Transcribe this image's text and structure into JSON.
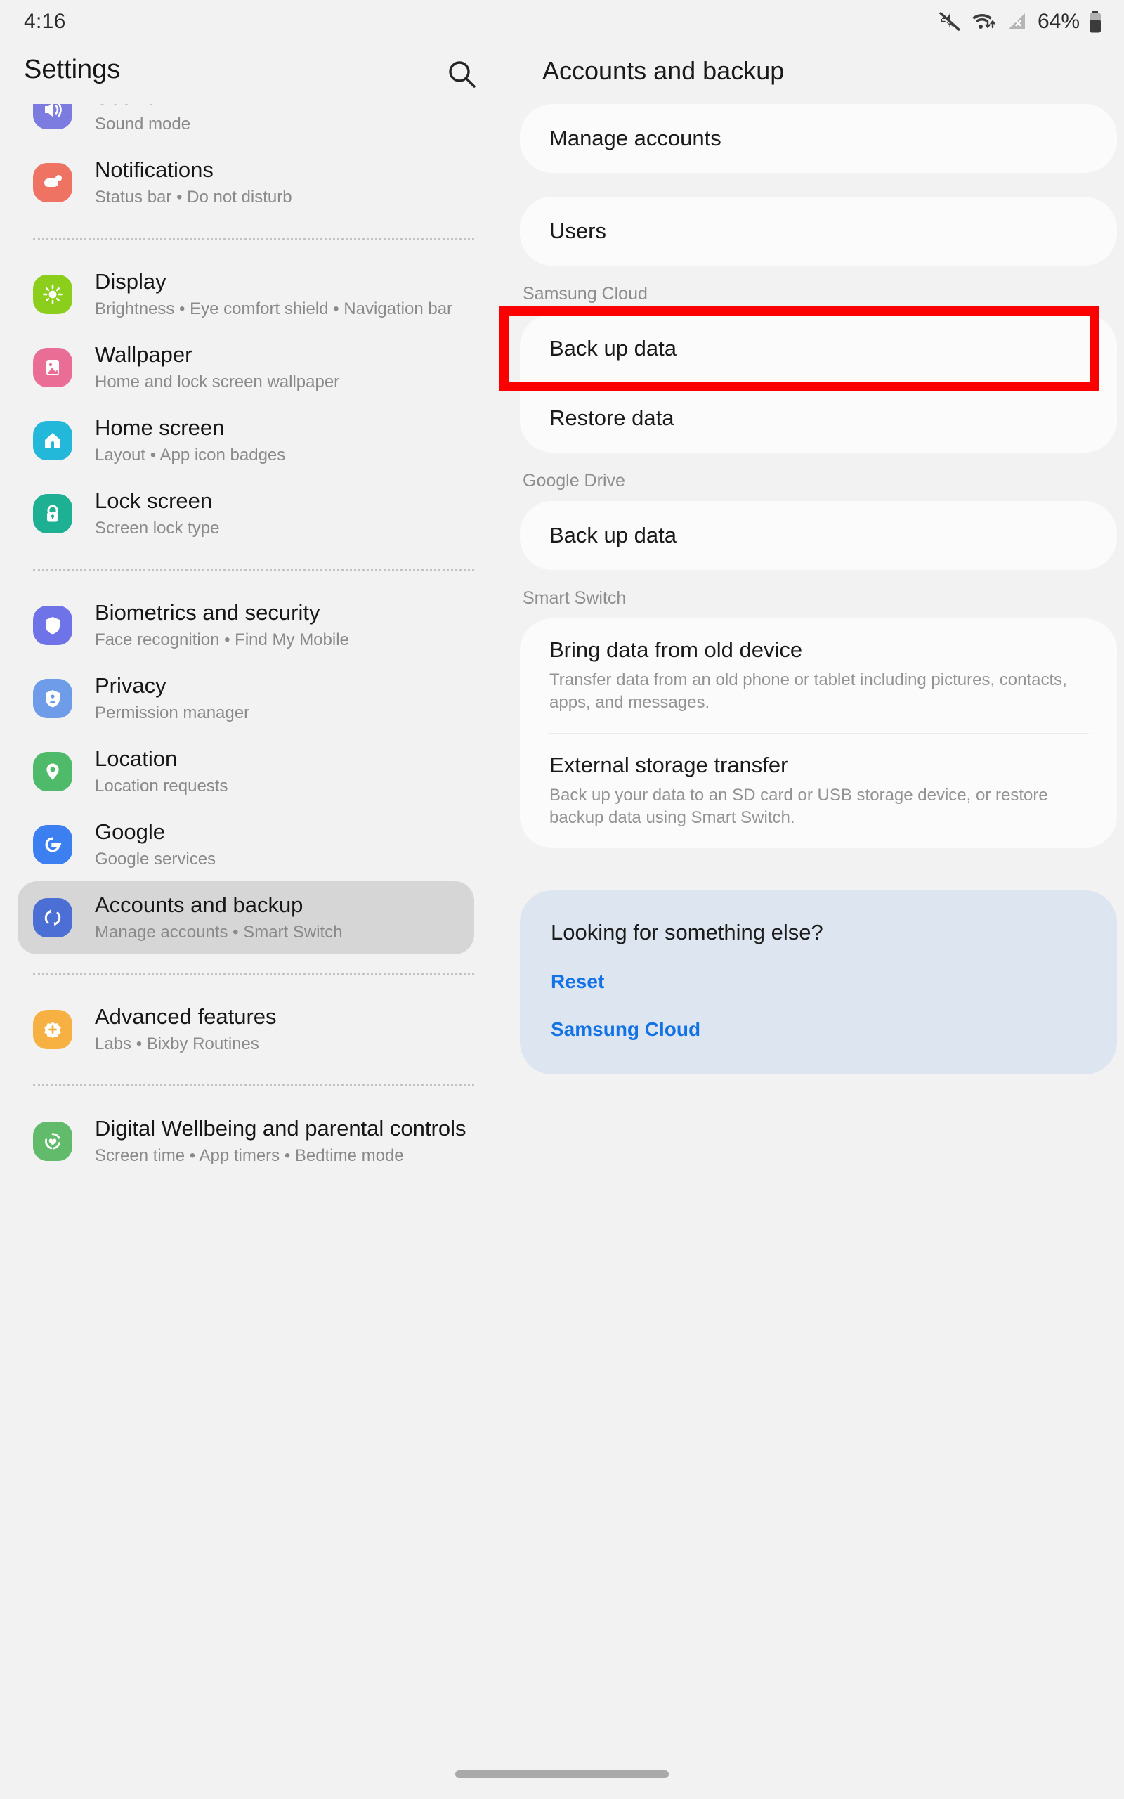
{
  "status_bar": {
    "time": "4:16",
    "battery_percent": "64%",
    "icons": [
      "mute-icon",
      "wifi-transfer-icon",
      "no-sim-signal-icon",
      "battery-icon"
    ]
  },
  "header": {
    "settings_label": "Settings",
    "search_icon": "search-icon",
    "page_title": "Accounts and backup"
  },
  "sidebar": {
    "items": [
      {
        "title": "Sound",
        "subtitle": "Sound mode",
        "icon": "sound-icon",
        "color": "#7c7ce0",
        "clipped": true
      },
      {
        "title": "Notifications",
        "subtitle": "Status bar  •  Do not disturb",
        "icon": "notifications-icon",
        "color": "#ef7363"
      },
      {
        "title": "Display",
        "subtitle": "Brightness  •  Eye comfort shield  •  Navigation bar",
        "icon": "display-icon",
        "color": "#8bcf1c"
      },
      {
        "title": "Wallpaper",
        "subtitle": "Home and lock screen wallpaper",
        "icon": "wallpaper-icon",
        "color": "#ea6d96"
      },
      {
        "title": "Home screen",
        "subtitle": "Layout  •  App icon badges",
        "icon": "home-screen-icon",
        "color": "#23b8d9"
      },
      {
        "title": "Lock screen",
        "subtitle": "Screen lock type",
        "icon": "lock-screen-icon",
        "color": "#1eb093"
      },
      {
        "title": "Biometrics and security",
        "subtitle": "Face recognition  •  Find My Mobile",
        "icon": "shield-icon",
        "color": "#6e74e8"
      },
      {
        "title": "Privacy",
        "subtitle": "Permission manager",
        "icon": "privacy-shield-icon",
        "color": "#6e9ce8"
      },
      {
        "title": "Location",
        "subtitle": "Location requests",
        "icon": "location-pin-icon",
        "color": "#4fbb6a"
      },
      {
        "title": "Google",
        "subtitle": "Google services",
        "icon": "google-g-icon",
        "color": "#3b7ff0"
      },
      {
        "title": "Accounts and backup",
        "subtitle": "Manage accounts  •  Smart Switch",
        "icon": "sync-accounts-icon",
        "color": "#4b6fd4",
        "selected": true
      },
      {
        "title": "Advanced features",
        "subtitle": "Labs  •  Bixby Routines",
        "icon": "advanced-gear-icon",
        "color": "#f7b042"
      },
      {
        "title": "Digital Wellbeing and parental controls",
        "subtitle": "Screen time  •  App timers  •  Bedtime mode",
        "icon": "wellbeing-heart-icon",
        "color": "#62bb6a"
      }
    ]
  },
  "main": {
    "top_rows": [
      {
        "title": "Manage accounts"
      },
      {
        "title": "Users"
      }
    ],
    "groups": [
      {
        "label": "Samsung Cloud",
        "rows": [
          {
            "title": "Back up data",
            "highlighted": true
          },
          {
            "title": "Restore data"
          }
        ]
      },
      {
        "label": "Google Drive",
        "rows": [
          {
            "title": "Back up data"
          }
        ]
      },
      {
        "label": "Smart Switch",
        "rows": [
          {
            "title": "Bring data from old device",
            "desc": "Transfer data from an old phone or tablet including pictures, contacts, apps, and messages."
          },
          {
            "title": "External storage transfer",
            "desc": "Back up your data to an SD card or USB storage device, or restore backup data using Smart Switch."
          }
        ]
      }
    ],
    "suggestion": {
      "title": "Looking for something else?",
      "links": [
        "Reset",
        "Samsung Cloud"
      ]
    }
  },
  "navigation_bar": {
    "handle": "home-gesture-handle"
  },
  "colors": {
    "highlight_box": "#fc0000",
    "link": "#1373e6",
    "suggestion_bg": "#dde6f0",
    "selected_row_bg": "#d6d6d6",
    "page_bg": "#f2f2f2",
    "card_bg": "#fbfbfb"
  }
}
